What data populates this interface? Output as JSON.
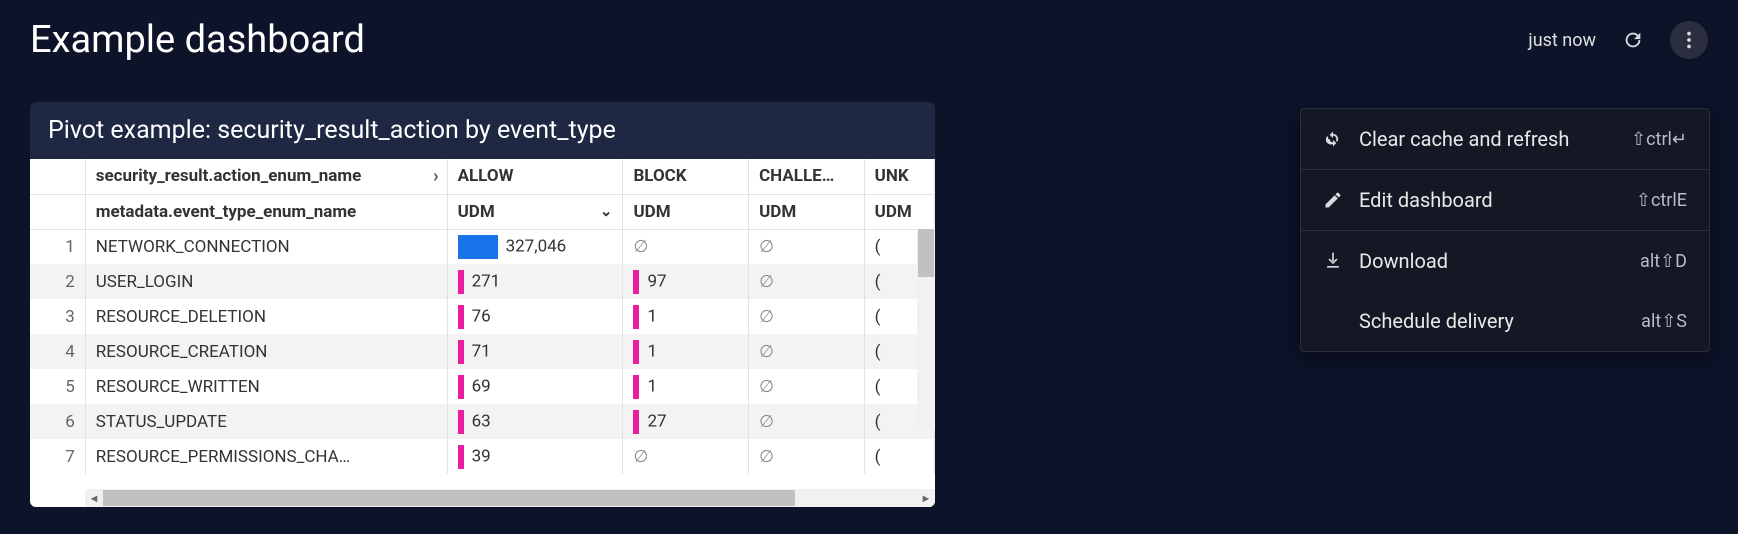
{
  "header": {
    "title": "Example dashboard",
    "timestamp": "just now"
  },
  "panel": {
    "title": "Pivot example: security_result_action by event_type",
    "columns": {
      "name_header": "security_result.action_enum_name",
      "subheader": "metadata.event_type_enum_name",
      "c1": "ALLOW",
      "c2": "BLOCK",
      "c3": "CHALLE…",
      "c4": "UNK",
      "sub": "UDM"
    },
    "rows": [
      {
        "n": "1",
        "name": "NETWORK_CONNECTION",
        "allow": "327,046",
        "allow_bar": "blue",
        "block": "∅",
        "block_bar": "",
        "chal": "∅"
      },
      {
        "n": "2",
        "name": "USER_LOGIN",
        "allow": "271",
        "allow_bar": "pink",
        "block": "97",
        "block_bar": "pink",
        "chal": "∅"
      },
      {
        "n": "3",
        "name": "RESOURCE_DELETION",
        "allow": "76",
        "allow_bar": "pink",
        "block": "1",
        "block_bar": "pink",
        "chal": "∅"
      },
      {
        "n": "4",
        "name": "RESOURCE_CREATION",
        "allow": "71",
        "allow_bar": "pink",
        "block": "1",
        "block_bar": "pink",
        "chal": "∅"
      },
      {
        "n": "5",
        "name": "RESOURCE_WRITTEN",
        "allow": "69",
        "allow_bar": "pink",
        "block": "1",
        "block_bar": "pink",
        "chal": "∅"
      },
      {
        "n": "6",
        "name": "STATUS_UPDATE",
        "allow": "63",
        "allow_bar": "pink",
        "block": "27",
        "block_bar": "pink",
        "chal": "∅"
      },
      {
        "n": "7",
        "name": "RESOURCE_PERMISSIONS_CHA…",
        "allow": "39",
        "allow_bar": "pink",
        "block": "∅",
        "block_bar": "",
        "chal": "∅"
      }
    ]
  },
  "menu": {
    "items": [
      {
        "label": "Clear cache and refresh",
        "shortcut": "⇧ctrl↵",
        "icon": "refresh-double"
      },
      {
        "label": "Edit dashboard",
        "shortcut": "⇧ctrlE",
        "icon": "pencil"
      },
      {
        "label": "Download",
        "shortcut": "alt⇧D",
        "icon": "download"
      },
      {
        "label": "Schedule delivery",
        "shortcut": "alt⇧S",
        "icon": ""
      }
    ]
  }
}
